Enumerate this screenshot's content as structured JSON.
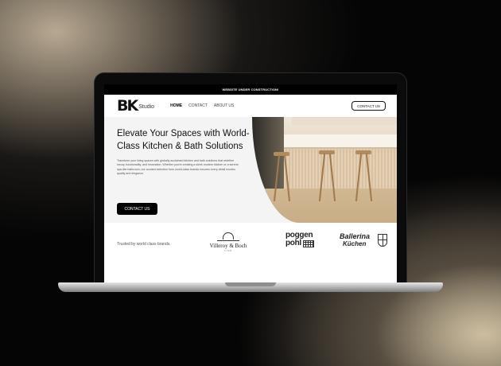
{
  "announcement": "WEBSITE UNDER CONSTRUCTION!",
  "logo": {
    "mark": "BK",
    "studio": "Studio"
  },
  "nav": {
    "items": [
      "HOME",
      "CONTACT",
      "ABOUT US"
    ],
    "cta": "CONTACT US"
  },
  "hero": {
    "title": "Elevate Your Spaces with World-Class Kitchen & Bath Solutions",
    "body": "Transform your living spaces with globally acclaimed kitchen and bath solutions that redefine luxury, functionality, and innovation. Whether you're creating a sleek modern kitchen or a serene, spa-like bathroom, our curated selection from world-class brands ensures every detail exudes quality and elegance.",
    "cta": "CONTACT US"
  },
  "brands": {
    "intro": "Trusted by world class brands.",
    "villeroy": {
      "name": "Villeroy & Boch",
      "sub": "1748"
    },
    "poggenpohl": {
      "line1": "poggen",
      "line2": "pohl"
    },
    "ballerina": {
      "line1": "Ballerina",
      "line2": "Küchen"
    }
  }
}
